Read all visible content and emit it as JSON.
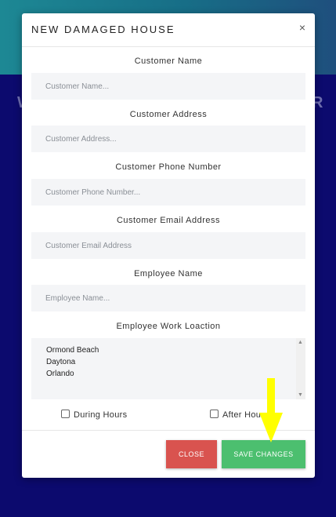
{
  "background": {
    "ghost_left": "W",
    "ghost_right": "R"
  },
  "modal": {
    "title": "NEW DAMAGED HOUSE",
    "close_glyph": "×"
  },
  "fields": {
    "customer_name": {
      "label": "Customer Name",
      "placeholder": "Customer Name..."
    },
    "customer_address": {
      "label": "Customer Address",
      "placeholder": "Customer Address..."
    },
    "customer_phone": {
      "label": "Customer Phone Number",
      "placeholder": "Customer Phone Number..."
    },
    "customer_email": {
      "label": "Customer Email Address",
      "placeholder": "Customer Email Address"
    },
    "employee_name": {
      "label": "Employee Name",
      "placeholder": "Employee Name..."
    },
    "work_location": {
      "label": "Employee Work Loaction",
      "options": [
        "Ormond Beach",
        "Daytona",
        "Orlando"
      ]
    }
  },
  "checkboxes": {
    "during_hours": "During Hours",
    "after_hours": "After Hours"
  },
  "buttons": {
    "close": "CLOSE",
    "save": "SAVE CHANGES"
  },
  "colors": {
    "close_button": "#d9534f",
    "save_button": "#4cbf6f",
    "annotation_arrow": "#ffff00"
  }
}
